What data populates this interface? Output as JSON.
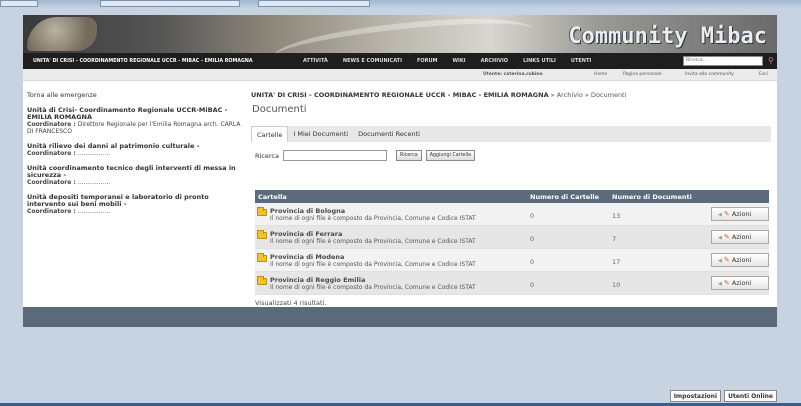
{
  "banner": {
    "brand": "Community Mibac"
  },
  "nav": {
    "site": "UNITA' DI CRISI - COORDINAMENTO REGIONALE UCCR - MIBAC - EMILIA ROMAGNA",
    "items": [
      "ATTIVITÀ",
      "NEWS E COMUNICATI",
      "FORUM",
      "WIKI",
      "ARCHIVIO",
      "LINKS UTILI",
      "UTENTI"
    ],
    "search_placeholder": "Ricerca..."
  },
  "userbar": {
    "user": "Utente: caterina.rubino",
    "home": "Home",
    "personal": "Pagina personale",
    "invite": "Invita alla community",
    "exit": "Esci"
  },
  "sidebar": {
    "back": "Torna alle emergenze",
    "units": [
      {
        "title": "Unità di Crisi- Coordinamento Regionale UCCR-MiBAC - EMILIA ROMAGNA",
        "coord_label": "Coordinatore :",
        "coord_value": "Direttore Regionale per l'Emilia Romagna arch. CARLA DI FRANCESCO"
      },
      {
        "title": "Unità rilievo dei danni al patrimonio culturale -",
        "coord_label": "Coordinatore :",
        "coord_value": "................."
      },
      {
        "title": "Unità coordinamento tecnico degli interventi di messa in sicurezza -",
        "coord_label": "Coordinatore :",
        "coord_value": "................."
      },
      {
        "title": "Unità depositi temporanei e laboratorio di pronto intervento sui beni mobili -",
        "coord_label": "Coordinatore :",
        "coord_value": "................."
      }
    ]
  },
  "main": {
    "breadcrumb_bold": "UNITA' DI CRISI - COORDINAMENTO REGIONALE UCCR - MIBAC - EMILIA ROMAGNA",
    "breadcrumb_rest": " » Archivio » Documenti",
    "heading": "Documenti",
    "tabs": [
      "Cartelle",
      "I Miei Documenti",
      "Documenti Recenti"
    ],
    "search_label": "Ricerca",
    "search_button": "Ricerca",
    "add_folder_button": "Aggiungi Cartella",
    "table": {
      "headers": [
        "Cartella",
        "Numero di Cartelle",
        "Numero di Documenti"
      ],
      "rows": [
        {
          "name": "Provincia di Bologna",
          "desc": "Il nome di ogni file è composto da Provincia, Comune e Codice ISTAT",
          "folders": "0",
          "docs": "13",
          "action": "Azioni"
        },
        {
          "name": "Provincia di Ferrara",
          "desc": "Il nome di ogni file è composto da Provincia, Comune e Codice ISTAT",
          "folders": "0",
          "docs": "7",
          "action": "Azioni"
        },
        {
          "name": "Provincia di Modena",
          "desc": "Il nome di ogni file è composto da Provincia, Comune e Codice ISTAT",
          "folders": "0",
          "docs": "17",
          "action": "Azioni"
        },
        {
          "name": "Provincia di Reggio Emilia",
          "desc": "Il nome di ogni file è composto da Provincia, Comune e Codice ISTAT",
          "folders": "0",
          "docs": "10",
          "action": "Azioni"
        }
      ]
    },
    "results": "Visualizzati 4 risultati."
  },
  "status_buttons": [
    "Impostazioni",
    "Utenti Online"
  ]
}
